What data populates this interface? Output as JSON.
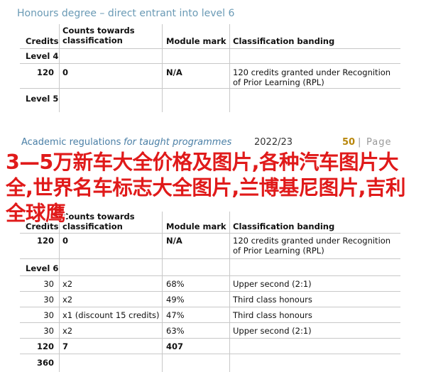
{
  "top": {
    "heading": "Honours degree – direct entrant into level 6",
    "columns": [
      "Credits",
      "Counts towards classification",
      "Module mark",
      "Classification banding"
    ],
    "level_rows": [
      "Level 4",
      "Level 5"
    ],
    "row": {
      "credits": "120",
      "counts": "0",
      "mark": "N/A",
      "banding": "120 credits granted under Recognition of Prior Learning (RPL)"
    }
  },
  "page_bar": {
    "title_normal": "Academic regulations",
    "title_italic": "for taught programmes",
    "year": "2022/23",
    "page_num": "50",
    "separator": "|",
    "page_word": "Page"
  },
  "overlay_text": "3—5万新车大全价格及图片,各种汽车图片大全,世界名车标志大全图片,兰博基尼图片,吉利全球鹰",
  "bottom": {
    "columns": [
      "Credits",
      "Counts towards classification",
      "Module mark",
      "Classification banding"
    ],
    "row_rpl": {
      "credits": "120",
      "counts": "0",
      "mark": "N/A",
      "banding": "120 credits granted under Recognition of Prior Learning (RPL)"
    },
    "level_label": "Level 6",
    "modules": [
      {
        "credits": "30",
        "counts": "x2",
        "mark": "68%",
        "banding": "Upper second (2:1)"
      },
      {
        "credits": "30",
        "counts": "x2",
        "mark": "49%",
        "banding": "Third class honours"
      },
      {
        "credits": "30",
        "counts": "x1 (discount 15 credits)",
        "mark": "47%",
        "banding": "Third class honours"
      },
      {
        "credits": "30",
        "counts": "x2",
        "mark": "63%",
        "banding": "Upper second (2:1)"
      }
    ],
    "total": {
      "credits": "120",
      "counts": "7",
      "mark": "407"
    },
    "grand_total": "360"
  },
  "colors": {
    "heading": "#6a9ab5",
    "overlay": "#e01a1a",
    "page_accent": "#b8860b"
  }
}
